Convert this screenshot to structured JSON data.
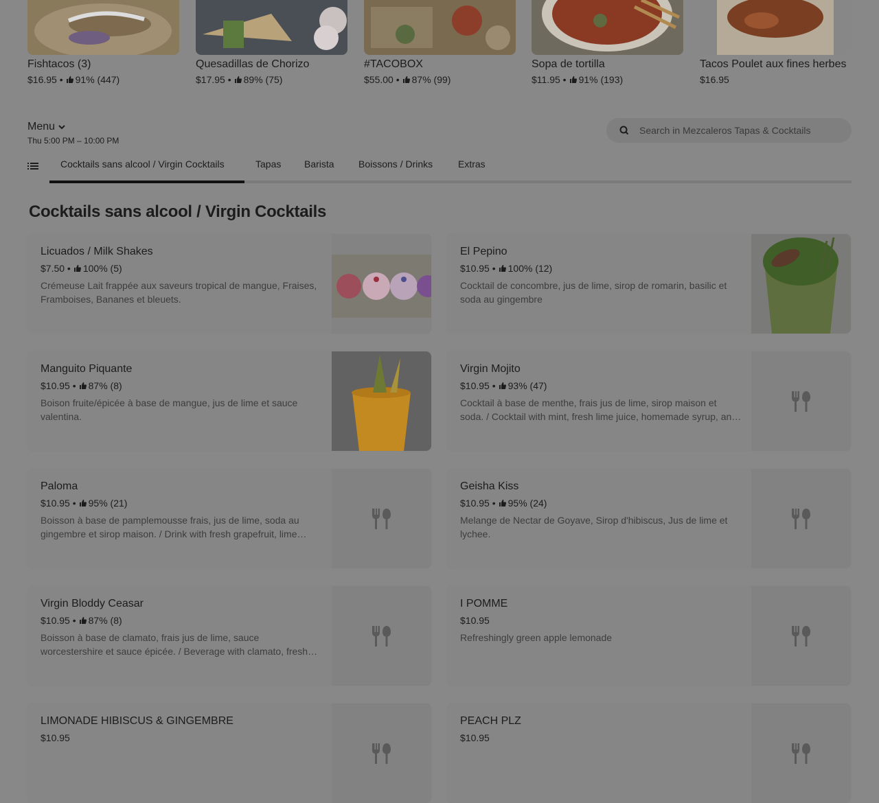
{
  "featured": [
    {
      "name": "Fishtacos (3)",
      "price": "$16.95",
      "rating": "91% (447)"
    },
    {
      "name": "Quesadillas de Chorizo",
      "price": "$17.95",
      "rating": "89% (75)"
    },
    {
      "name": "#TACOBOX",
      "price": "$55.00",
      "rating": "87% (99)"
    },
    {
      "name": "Sopa de tortilla",
      "price": "$11.95",
      "rating": "91% (193)"
    },
    {
      "name": "Tacos Poulet aux fines herbes",
      "price": "$16.95",
      "rating": ""
    }
  ],
  "menu": {
    "title": "Menu",
    "hours": "Thu 5:00 PM – 10:00 PM"
  },
  "search": {
    "placeholder": "Search in Mezcaleros Tapas & Cocktails"
  },
  "tabs": [
    "Cocktails sans alcool / Virgin Cocktails",
    "Tapas",
    "Barista",
    "Boissons / Drinks",
    "Extras"
  ],
  "section": {
    "title": "Cocktails sans alcool / Virgin Cocktails"
  },
  "items": [
    {
      "name": "Licuados / Milk Shakes",
      "price": "$7.50",
      "rating": "100% (5)",
      "desc": "Crémeuse Lait frappée aux saveurs tropical de mangue, Fraises, Framboises, Bananes et bleuets.",
      "image": "milkshakes"
    },
    {
      "name": "El Pepino",
      "price": "$10.95",
      "rating": "100% (12)",
      "desc": "Cocktail de concombre, jus de lime, sirop de romarin, basilic et soda au gingembre",
      "image": "pepino"
    },
    {
      "name": "Manguito Piquante",
      "price": "$10.95",
      "rating": "87% (8)",
      "desc": "Boison fruite/épicée à base de mangue, jus de lime et sauce valentina.",
      "image": "mango"
    },
    {
      "name": "Virgin Mojito",
      "price": "$10.95",
      "rating": "93% (47)",
      "desc": "Cocktail à base de menthe, frais jus de lime, sirop maison et soda. / Cocktail with mint, fresh lime juice, homemade syrup, and soda.",
      "image": "placeholder"
    },
    {
      "name": "Paloma",
      "price": "$10.95",
      "rating": "95% (21)",
      "desc": "Boisson à base de pamplemousse frais, jus de lime, soda au gingembre et sirop maison. / Drink with fresh grapefruit, lime juice, ginger soda, and homemade syrup.",
      "image": "placeholder"
    },
    {
      "name": "Geisha Kiss",
      "price": "$10.95",
      "rating": "95% (24)",
      "desc": "Melange de Nectar de Goyave, Sirop d'hibiscus, Jus de lime et lychee.",
      "image": "placeholder"
    },
    {
      "name": "Virgin Bloddy Ceasar",
      "price": "$10.95",
      "rating": "87% (8)",
      "desc": "Boisson à base de clamato, frais jus de lime, sauce worcestershire et sauce épicée. / Beverage with clamato, fresh lime juice, worcestershire sauce, and hot sauce.",
      "image": "placeholder"
    },
    {
      "name": "I POMME",
      "price": "$10.95",
      "rating": "",
      "desc": "Refreshingly green apple lemonade",
      "image": "placeholder"
    },
    {
      "name": "LIMONADE HIBISCUS & GINGEMBRE",
      "price": "$10.95",
      "rating": "",
      "desc": "",
      "image": "placeholder"
    },
    {
      "name": "PEACH PLZ",
      "price": "$10.95",
      "rating": "",
      "desc": "",
      "image": "placeholder"
    }
  ]
}
